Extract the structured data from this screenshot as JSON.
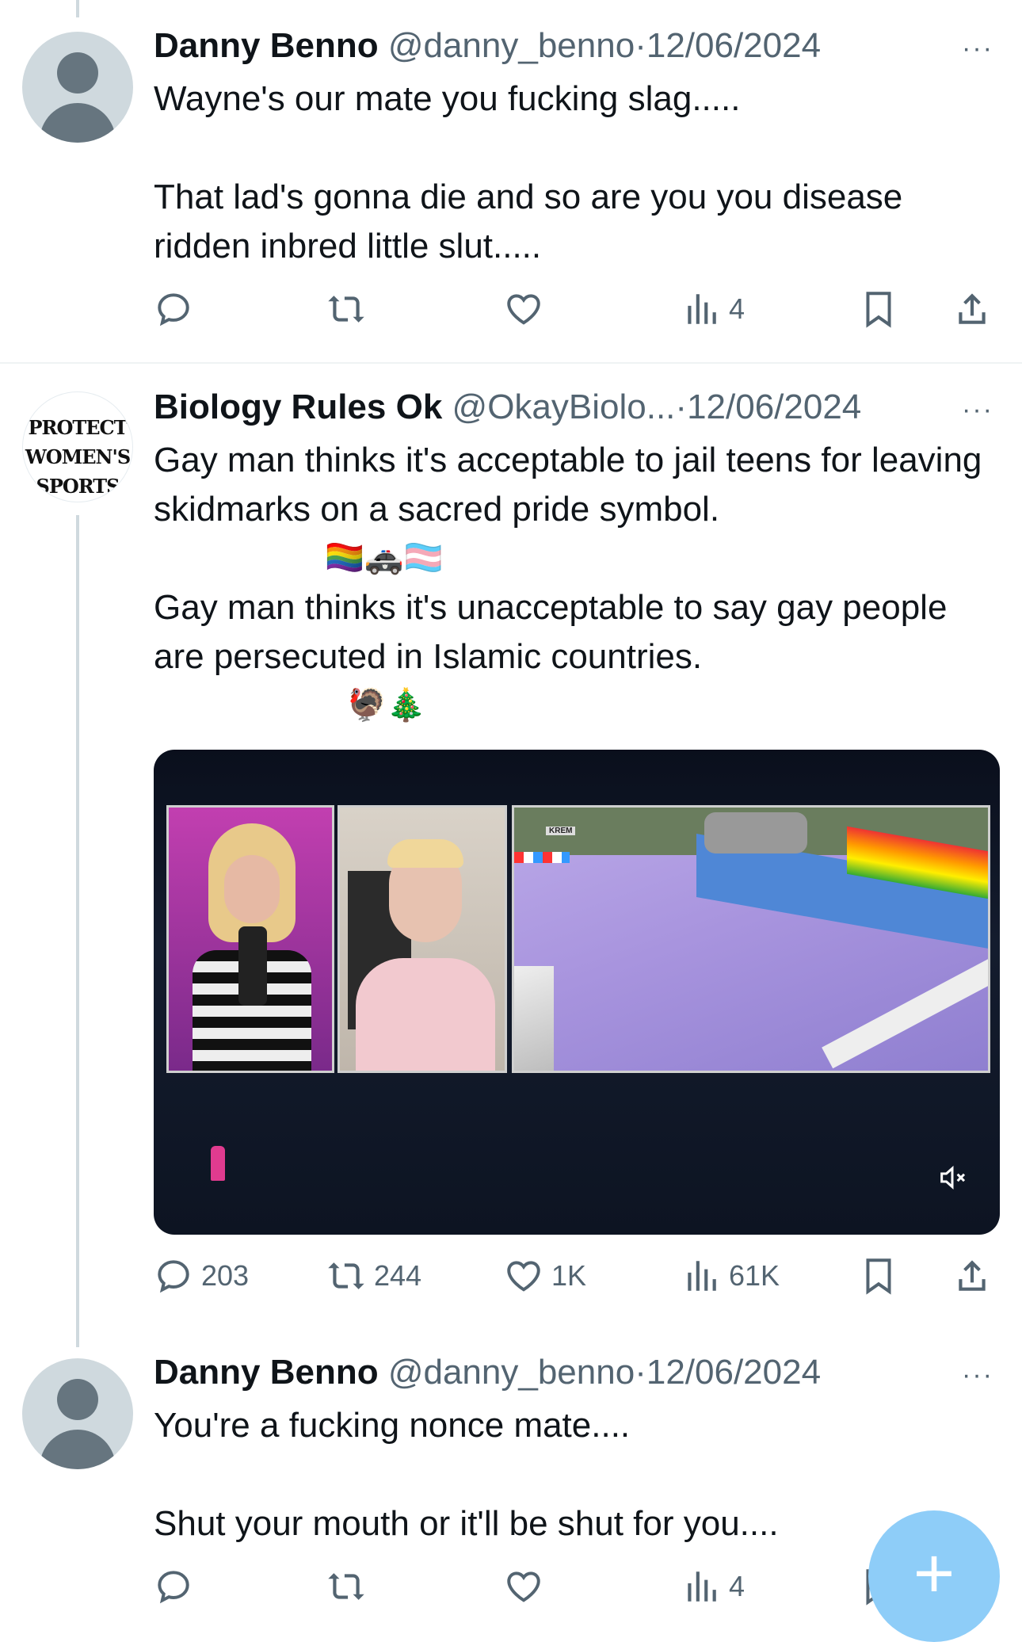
{
  "tweets": [
    {
      "name": "Danny Benno",
      "handle": "@danny_benno",
      "separator": "·",
      "date": "12/06/2024",
      "more": "···",
      "paragraphs": [
        "Wayne's our mate you fucking slag.....",
        "That lad's gonna die and so are you you disease ridden inbred little slut....."
      ],
      "views": "4"
    },
    {
      "name": "Biology Rules Ok",
      "handle": "@OkayBiolo...",
      "separator": "·",
      "date": "12/06/2024",
      "more": "···",
      "avatar_text": "PROTECT WOMEN'S SPORTS",
      "paragraphs": [
        "Gay man thinks it's acceptable to jail teens for leaving skidmarks on a sacred pride symbol.",
        "Gay man thinks it's unacceptable to say gay people are persecuted in Islamic countries."
      ],
      "emoji_row_1": "🏳️‍🌈🚓🏳️‍⚧️",
      "emoji_row_2": "🦃🎄",
      "replies": "203",
      "reposts": "244",
      "likes": "1K",
      "views": "61K",
      "media": {
        "label": "KREM",
        "mute_icon": "speaker-mute-icon"
      }
    },
    {
      "name": "Danny Benno",
      "handle": "@danny_benno",
      "separator": "·",
      "date": "12/06/2024",
      "more": "···",
      "paragraphs": [
        "You're a fucking nonce mate....",
        "Shut your mouth or it'll be shut for you...."
      ],
      "views": "4"
    }
  ],
  "fab": {
    "label": "+"
  },
  "colors": {
    "text": "#0f1419",
    "secondary": "#536471",
    "fab": "#8ecdf8"
  }
}
